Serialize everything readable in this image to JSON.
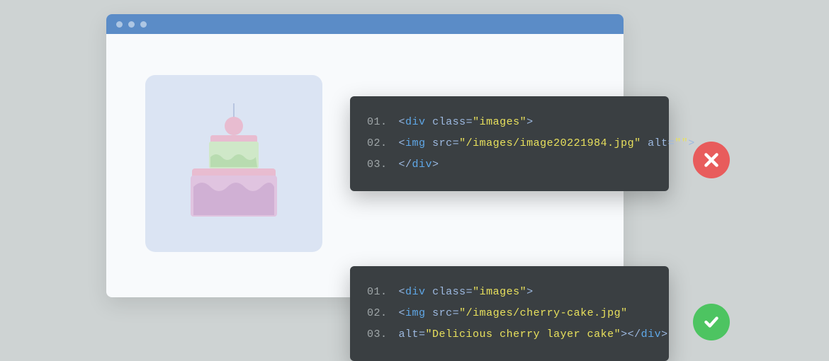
{
  "codeBad": {
    "lines": [
      {
        "num": "01.",
        "tokens": [
          {
            "t": "bracket",
            "v": "<"
          },
          {
            "t": "tag",
            "v": "div"
          },
          {
            "t": "plain",
            "v": " "
          },
          {
            "t": "attr",
            "v": "class"
          },
          {
            "t": "eq",
            "v": "="
          },
          {
            "t": "str",
            "v": "\"images\""
          },
          {
            "t": "bracket",
            "v": ">"
          }
        ]
      },
      {
        "num": "02.",
        "tokens": [
          {
            "t": "bracket",
            "v": "<"
          },
          {
            "t": "tag",
            "v": "img"
          },
          {
            "t": "plain",
            "v": " "
          },
          {
            "t": "attr",
            "v": "src"
          },
          {
            "t": "eq",
            "v": "="
          },
          {
            "t": "str",
            "v": "\"/images/image20221984.jpg\""
          },
          {
            "t": "plain",
            "v": " "
          },
          {
            "t": "attr",
            "v": "alt"
          },
          {
            "t": "eq",
            "v": "="
          },
          {
            "t": "str",
            "v": "\"\""
          },
          {
            "t": "bracket",
            "v": ">"
          }
        ]
      },
      {
        "num": "03.",
        "tokens": [
          {
            "t": "bracket",
            "v": "</"
          },
          {
            "t": "tag",
            "v": "div"
          },
          {
            "t": "bracket",
            "v": ">"
          }
        ]
      }
    ]
  },
  "codeGood": {
    "lines": [
      {
        "num": "01.",
        "tokens": [
          {
            "t": "bracket",
            "v": "<"
          },
          {
            "t": "tag",
            "v": "div"
          },
          {
            "t": "plain",
            "v": " "
          },
          {
            "t": "attr",
            "v": "class"
          },
          {
            "t": "eq",
            "v": "="
          },
          {
            "t": "str",
            "v": "\"images\""
          },
          {
            "t": "bracket",
            "v": ">"
          }
        ]
      },
      {
        "num": "02.",
        "tokens": [
          {
            "t": "bracket",
            "v": "<"
          },
          {
            "t": "tag",
            "v": "img"
          },
          {
            "t": "plain",
            "v": " "
          },
          {
            "t": "attr",
            "v": "src"
          },
          {
            "t": "eq",
            "v": "="
          },
          {
            "t": "str",
            "v": "\"/images/cherry-cake.jpg\""
          }
        ]
      },
      {
        "num": "03.",
        "tokens": [
          {
            "t": "attr",
            "v": "alt"
          },
          {
            "t": "eq",
            "v": "="
          },
          {
            "t": "str",
            "v": "\"Delicious cherry layer cake\""
          },
          {
            "t": "bracket",
            "v": "></"
          },
          {
            "t": "tag",
            "v": "div"
          },
          {
            "t": "bracket",
            "v": ">"
          }
        ]
      }
    ]
  }
}
